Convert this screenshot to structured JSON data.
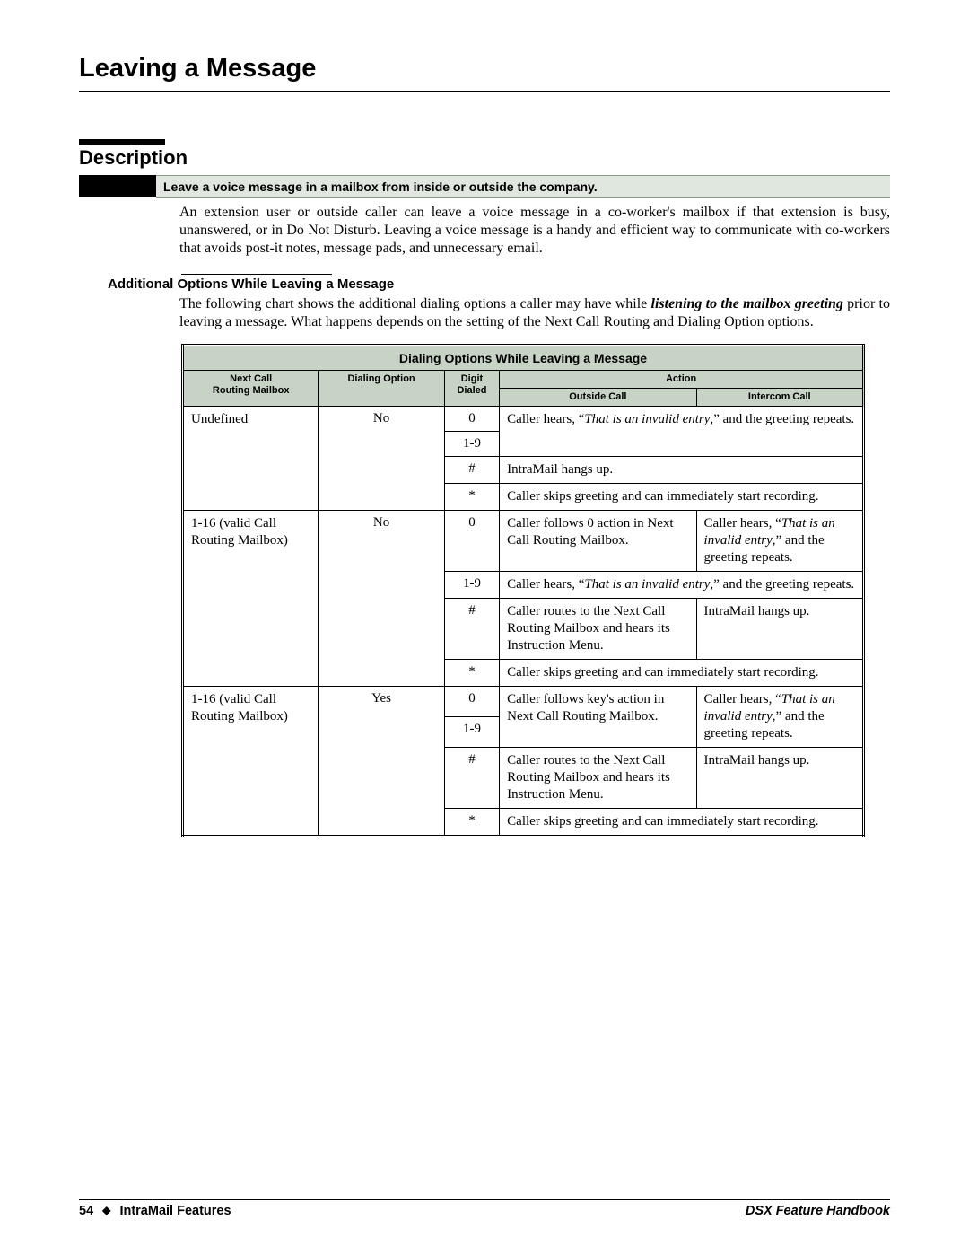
{
  "page": {
    "title": "Leaving a Message",
    "description_heading": "Description",
    "feature_summary": "Leave a voice message in a mailbox from inside or outside the company.",
    "description_text": "An extension user or outside caller can leave a voice message in a co-worker's mailbox if that extension is busy, unanswered, or in Do Not Disturb. Leaving a voice message is a handy and efficient way to communicate with co-workers that avoids post-it notes, message pads, and unnecessary email.",
    "sub_heading": "Additional Options While Leaving a Message",
    "sub_text_pre": "The following chart shows the additional dialing options a caller may have while ",
    "sub_text_emph": "listening to the mailbox greeting",
    "sub_text_post": " prior to leaving a message. What happens depends on the setting of the Next Call Routing and Dialing Option options."
  },
  "table": {
    "title": "Dialing Options While Leaving a Message",
    "headers": {
      "col1_line1": "Next Call",
      "col1_line2": "Routing Mailbox",
      "col2": "Dialing Option",
      "col3_line1": "Digit",
      "col3_line2": "Dialed",
      "col4": "Action",
      "col4a": "Outside Call",
      "col4b": "Intercom Call"
    },
    "g1": {
      "mailbox": "Undefined",
      "option": "No",
      "r1_digit": "0",
      "r2_digit": "1-9",
      "r12_pre": "Caller hears, “",
      "r12_em": "That is an invalid entry",
      "r12_post": ",” and the greeting repeats.",
      "r3_digit": "#",
      "r3_action": "IntraMail hangs up.",
      "r4_digit": "*",
      "r4_action": "Caller skips greeting and can immediately start recording."
    },
    "g2": {
      "mailbox": "1-16 (valid Call Routing Mailbox)",
      "option": "No",
      "r1_digit": "0",
      "r1_out": "Caller follows 0 action in Next Call Routing Mailbox.",
      "r1_int_pre": "Caller hears, “",
      "r1_int_em": "That is an invalid entry",
      "r1_int_post": ",” and the greeting repeats.",
      "r2_digit": "1-9",
      "r2_pre": "Caller hears, “",
      "r2_em": "That is an invalid entry",
      "r2_post": ",” and the greeting repeats.",
      "r3_digit": "#",
      "r3_out": "Caller routes to the Next Call Routing Mailbox and hears its Instruction Menu.",
      "r3_int": "IntraMail hangs up.",
      "r4_digit": "*",
      "r4_action": "Caller skips greeting and can immediately start recording."
    },
    "g3": {
      "mailbox": "1-16 (valid Call Routing Mailbox)",
      "option": "Yes",
      "r1_digit": "0",
      "r2_digit": "1-9",
      "r12_out": "Caller follows key's action in Next Call Routing Mailbox.",
      "r12_int_pre": "Caller hears, “",
      "r12_int_em": "That is an invalid entry",
      "r12_int_post": ",” and the greeting repeats.",
      "r3_digit": "#",
      "r3_out": "Caller routes to the Next Call Routing Mailbox and hears its Instruction Menu.",
      "r3_int": "IntraMail hangs up.",
      "r4_digit": "*",
      "r4_action": "Caller skips greeting and can immediately start recording."
    }
  },
  "footer": {
    "page_num": "54",
    "section": "IntraMail Features",
    "book": "DSX Feature Handbook"
  }
}
